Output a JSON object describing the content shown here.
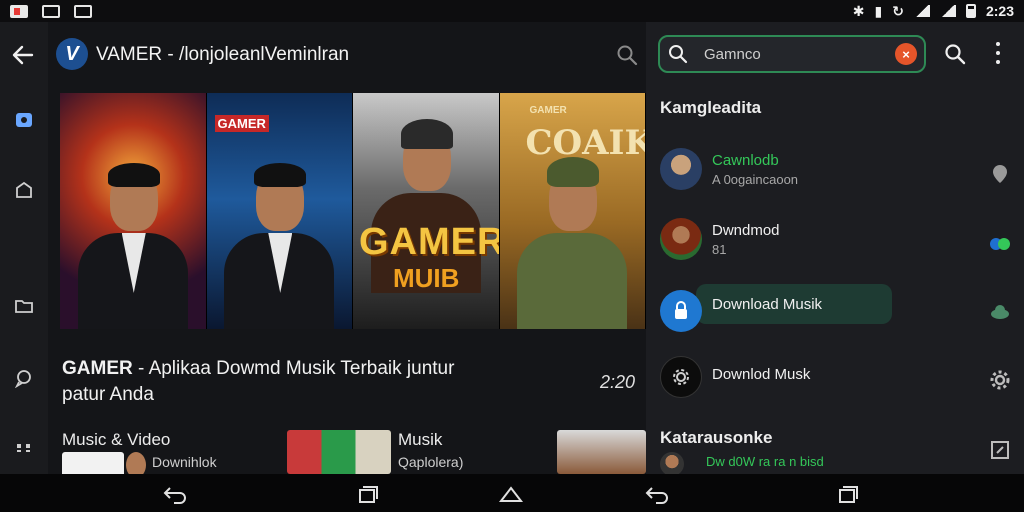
{
  "status_bar": {
    "time": "2:23"
  },
  "header": {
    "app_logo_letter": "V",
    "title": "VAMER - /lonjoleanlVeminlran"
  },
  "posters": [
    {
      "badge": "",
      "logo": "",
      "big": "",
      "sub": ""
    },
    {
      "badge": "",
      "logo": "GAMER",
      "big": "",
      "sub": ""
    },
    {
      "badge": "",
      "logo": "",
      "big": "GAMER",
      "sub": "MUIB"
    },
    {
      "badge": "GAMER",
      "logo": "COAIKO",
      "big": "",
      "sub": ""
    }
  ],
  "main": {
    "headline_bold": "GAMER",
    "headline_rest": " - Aplikaa Dowmd Musik Terbaik juntur patur Anda",
    "headline_time": "2:20",
    "rows": [
      {
        "label": "Music & Video",
        "sub": "Downihlok"
      },
      {
        "label": "Musik",
        "sub": "Qaplolera)"
      }
    ]
  },
  "panel": {
    "search_value": "Gamnco",
    "clear_label": "×",
    "section1_title": "Kamgleadita",
    "items": [
      {
        "title": "Cawnlodb",
        "subtitle": "A 0ogaincaoon",
        "title_color": "#34c759"
      },
      {
        "title": "Dwndmod",
        "subtitle": "81",
        "title_color": "#f0f0f0"
      },
      {
        "title": "Download Musik",
        "subtitle": "",
        "title_color": "#f0f0f0"
      },
      {
        "title": "Downlod Musk",
        "subtitle": "",
        "title_color": "#f0f0f0"
      }
    ],
    "section2_title": "Katarausonke",
    "section2_item": "Dw d0W ra ra n bisd"
  }
}
